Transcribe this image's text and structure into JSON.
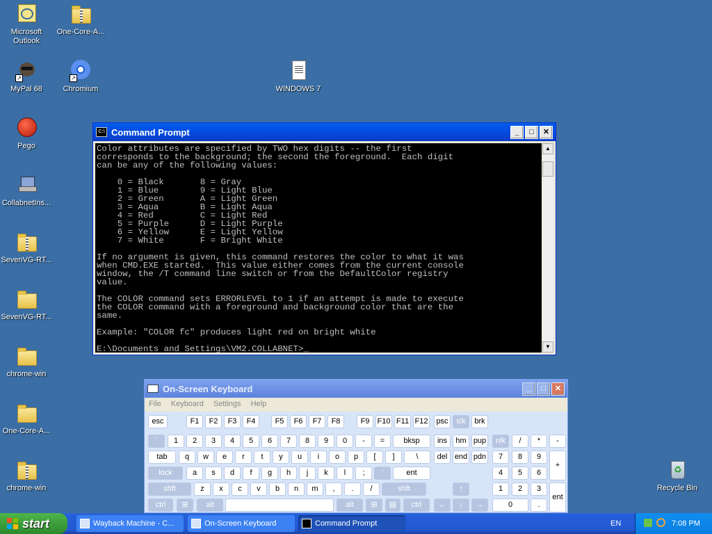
{
  "desktop": {
    "icons": [
      {
        "label": "Microsoft Outlook",
        "line1": "Microsoft",
        "line2": "Outlook"
      },
      {
        "label": "One-Core-A..."
      },
      {
        "label": "MyPal 68"
      },
      {
        "label": "Chromium"
      },
      {
        "label": "WINDOWS 7"
      },
      {
        "label": "Pego"
      },
      {
        "label": "CollabnetIns..."
      },
      {
        "label": "SevenVG-RT..."
      },
      {
        "label": "SevenVG-RT..."
      },
      {
        "label": "chrome-win"
      },
      {
        "label": "One-Core-A..."
      },
      {
        "label": "chrome-win"
      },
      {
        "label": "Recycle Bin"
      }
    ]
  },
  "cmd": {
    "title": "Command Prompt",
    "icon": "C:\\",
    "output": "Color attributes are specified by TWO hex digits -- the first\ncorresponds to the background; the second the foreground.  Each digit\ncan be any of the following values:\n\n    0 = Black       8 = Gray\n    1 = Blue        9 = Light Blue\n    2 = Green       A = Light Green\n    3 = Aqua        B = Light Aqua\n    4 = Red         C = Light Red\n    5 = Purple      D = Light Purple\n    6 = Yellow      E = Light Yellow\n    7 = White       F = Bright White\n\nIf no argument is given, this command restores the color to what it was\nwhen CMD.EXE started.  This value either comes from the current console\nwindow, the /T command line switch or from the DefaultColor registry\nvalue.\n\nThe COLOR command sets ERRORLEVEL to 1 if an attempt is made to execute\nthe COLOR command with a foreground and background color that are the\nsame.\n\nExample: \"COLOR fc\" produces light red on bright white\n\nE:\\Documents and Settings\\VM2.COLLABNET>_"
  },
  "osk": {
    "title": "On-Screen Keyboard",
    "menu": [
      "File",
      "Keyboard",
      "Settings",
      "Help"
    ],
    "keys": {
      "row1": [
        "esc",
        "F1",
        "F2",
        "F3",
        "F4",
        "F5",
        "F6",
        "F7",
        "F8",
        "F9",
        "F10",
        "F11",
        "F12",
        "psc",
        "slk",
        "brk"
      ],
      "row2": [
        "`",
        "1",
        "2",
        "3",
        "4",
        "5",
        "6",
        "7",
        "8",
        "9",
        "0",
        "-",
        "=",
        "bksp",
        "ins",
        "hm",
        "pup",
        "nlk",
        "/",
        "*",
        "-"
      ],
      "row3": [
        "tab",
        "q",
        "w",
        "e",
        "r",
        "t",
        "y",
        "u",
        "i",
        "o",
        "p",
        "[",
        "]",
        "\\",
        "del",
        "end",
        "pdn",
        "7",
        "8",
        "9",
        "+"
      ],
      "row4": [
        "lock",
        "a",
        "s",
        "d",
        "f",
        "g",
        "h",
        "j",
        "k",
        "l",
        ";",
        "'",
        "ent",
        "4",
        "5",
        "6"
      ],
      "row5": [
        "shft",
        "z",
        "x",
        "c",
        "v",
        "b",
        "n",
        "m",
        ",",
        ".",
        "/",
        "shft",
        "↑",
        "1",
        "2",
        "3",
        "ent"
      ],
      "row6": [
        "ctrl",
        "alt",
        "alt",
        "ctrl",
        "←",
        "↓",
        "→",
        "0",
        "."
      ]
    }
  },
  "taskbar": {
    "start": "start",
    "tasks": [
      "Wayback Machine - C...",
      "On-Screen Keyboard",
      "Command Prompt"
    ],
    "lang": "EN",
    "clock": "7:08 PM"
  },
  "colors": {
    "desktop": "#3a6ea5",
    "titlebar": "#0055ea",
    "osk_key": "#ffffff"
  }
}
